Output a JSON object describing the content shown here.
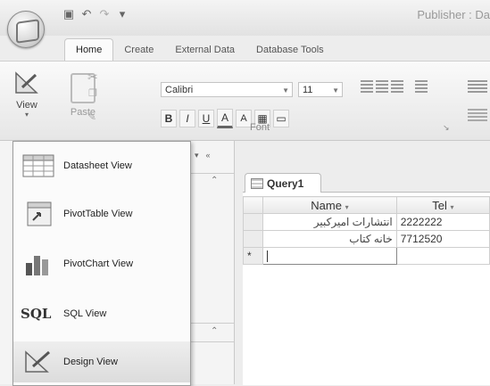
{
  "app": {
    "title": "Publisher : Da"
  },
  "quick_access": [
    "save-icon",
    "undo-icon",
    "redo-icon",
    "customize-icon"
  ],
  "tabs": [
    "Home",
    "Create",
    "External Data",
    "Database Tools"
  ],
  "ribbon": {
    "view_label": "View",
    "paste_label": "Paste",
    "font_name": "Calibri",
    "font_size": "11",
    "font_group_label": "Font",
    "format_buttons": [
      "B",
      "I",
      "U",
      "A",
      "A",
      "▦",
      "▭"
    ]
  },
  "view_menu": {
    "items": [
      {
        "label": "Datasheet View",
        "icon": "datasheet-icon"
      },
      {
        "label": "PivotTable View",
        "icon": "pivottable-icon"
      },
      {
        "label": "PivotChart View",
        "icon": "pivotchart-icon"
      },
      {
        "label": "SQL View",
        "icon": "sql-icon",
        "icon_text": "SQL"
      },
      {
        "label": "Design View",
        "icon": "design-icon"
      }
    ]
  },
  "nav_pane": {
    "collapse_glyph": "«"
  },
  "query": {
    "tab_label": "Query1",
    "columns": [
      "Name",
      "Tel"
    ],
    "rows": [
      {
        "name": "انتشارات امیرکبیر",
        "tel": "2222222"
      },
      {
        "name": "خانه کتاب",
        "tel": "7712520"
      }
    ],
    "new_row_marker": "*"
  }
}
